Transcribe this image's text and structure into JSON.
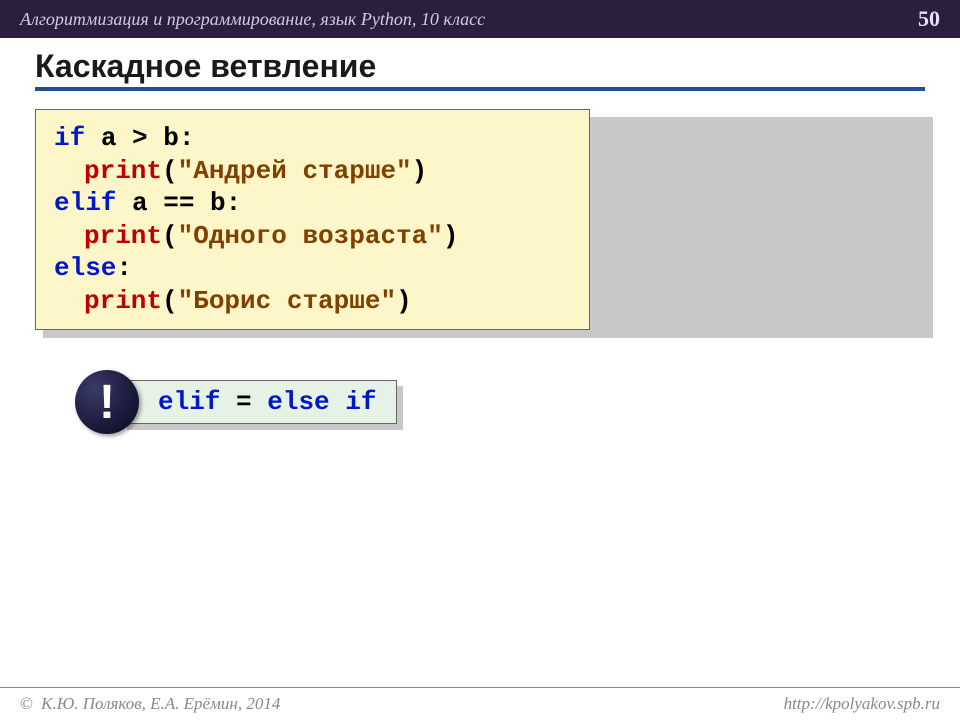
{
  "header": {
    "breadcrumb": "Алгоритмизация и программирование, язык Python, 10 класс",
    "page_number": "50"
  },
  "title": "Каскадное ветвление",
  "code": {
    "line1_kw": "if",
    "line1_rest": " a > b:",
    "line2_fn": "print",
    "line2_paren_open": "(",
    "line2_str": "\"Андрей старше\"",
    "line2_paren_close": ")",
    "line3_kw": "elif",
    "line3_rest": " a == b:",
    "line4_fn": "print",
    "line4_paren_open": "(",
    "line4_str": "\"Одного возраста\"",
    "line4_paren_close": ")",
    "line5_kw": "else",
    "line5_rest": ":",
    "line6_fn": "print",
    "line6_paren_open": "(",
    "line6_str": "\"Борис старше\"",
    "line6_paren_close": ")"
  },
  "note": {
    "badge": "!",
    "elif_kw": "elif",
    "equals": " = ",
    "else_kw": "else if"
  },
  "footer": {
    "left_symbol": "©",
    "left_text": " К.Ю. Поляков, Е.А. Ерёмин, 2014",
    "right": "http://kpolyakov.spb.ru"
  }
}
